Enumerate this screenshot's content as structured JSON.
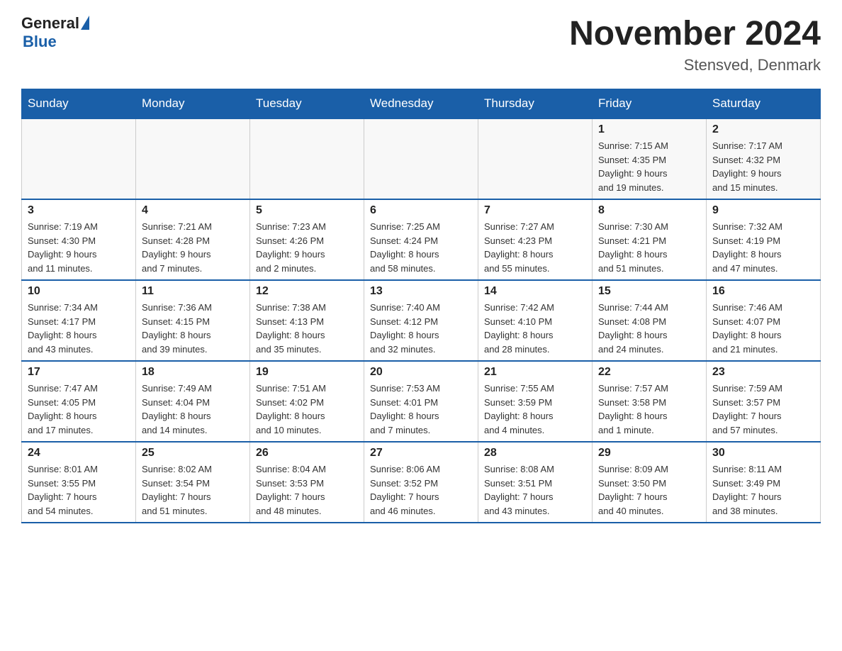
{
  "logo": {
    "general": "General",
    "blue": "Blue"
  },
  "header": {
    "title": "November 2024",
    "location": "Stensved, Denmark"
  },
  "days_of_week": [
    "Sunday",
    "Monday",
    "Tuesday",
    "Wednesday",
    "Thursday",
    "Friday",
    "Saturday"
  ],
  "weeks": [
    [
      {
        "day": "",
        "info": ""
      },
      {
        "day": "",
        "info": ""
      },
      {
        "day": "",
        "info": ""
      },
      {
        "day": "",
        "info": ""
      },
      {
        "day": "",
        "info": ""
      },
      {
        "day": "1",
        "info": "Sunrise: 7:15 AM\nSunset: 4:35 PM\nDaylight: 9 hours\nand 19 minutes."
      },
      {
        "day": "2",
        "info": "Sunrise: 7:17 AM\nSunset: 4:32 PM\nDaylight: 9 hours\nand 15 minutes."
      }
    ],
    [
      {
        "day": "3",
        "info": "Sunrise: 7:19 AM\nSunset: 4:30 PM\nDaylight: 9 hours\nand 11 minutes."
      },
      {
        "day": "4",
        "info": "Sunrise: 7:21 AM\nSunset: 4:28 PM\nDaylight: 9 hours\nand 7 minutes."
      },
      {
        "day": "5",
        "info": "Sunrise: 7:23 AM\nSunset: 4:26 PM\nDaylight: 9 hours\nand 2 minutes."
      },
      {
        "day": "6",
        "info": "Sunrise: 7:25 AM\nSunset: 4:24 PM\nDaylight: 8 hours\nand 58 minutes."
      },
      {
        "day": "7",
        "info": "Sunrise: 7:27 AM\nSunset: 4:23 PM\nDaylight: 8 hours\nand 55 minutes."
      },
      {
        "day": "8",
        "info": "Sunrise: 7:30 AM\nSunset: 4:21 PM\nDaylight: 8 hours\nand 51 minutes."
      },
      {
        "day": "9",
        "info": "Sunrise: 7:32 AM\nSunset: 4:19 PM\nDaylight: 8 hours\nand 47 minutes."
      }
    ],
    [
      {
        "day": "10",
        "info": "Sunrise: 7:34 AM\nSunset: 4:17 PM\nDaylight: 8 hours\nand 43 minutes."
      },
      {
        "day": "11",
        "info": "Sunrise: 7:36 AM\nSunset: 4:15 PM\nDaylight: 8 hours\nand 39 minutes."
      },
      {
        "day": "12",
        "info": "Sunrise: 7:38 AM\nSunset: 4:13 PM\nDaylight: 8 hours\nand 35 minutes."
      },
      {
        "day": "13",
        "info": "Sunrise: 7:40 AM\nSunset: 4:12 PM\nDaylight: 8 hours\nand 32 minutes."
      },
      {
        "day": "14",
        "info": "Sunrise: 7:42 AM\nSunset: 4:10 PM\nDaylight: 8 hours\nand 28 minutes."
      },
      {
        "day": "15",
        "info": "Sunrise: 7:44 AM\nSunset: 4:08 PM\nDaylight: 8 hours\nand 24 minutes."
      },
      {
        "day": "16",
        "info": "Sunrise: 7:46 AM\nSunset: 4:07 PM\nDaylight: 8 hours\nand 21 minutes."
      }
    ],
    [
      {
        "day": "17",
        "info": "Sunrise: 7:47 AM\nSunset: 4:05 PM\nDaylight: 8 hours\nand 17 minutes."
      },
      {
        "day": "18",
        "info": "Sunrise: 7:49 AM\nSunset: 4:04 PM\nDaylight: 8 hours\nand 14 minutes."
      },
      {
        "day": "19",
        "info": "Sunrise: 7:51 AM\nSunset: 4:02 PM\nDaylight: 8 hours\nand 10 minutes."
      },
      {
        "day": "20",
        "info": "Sunrise: 7:53 AM\nSunset: 4:01 PM\nDaylight: 8 hours\nand 7 minutes."
      },
      {
        "day": "21",
        "info": "Sunrise: 7:55 AM\nSunset: 3:59 PM\nDaylight: 8 hours\nand 4 minutes."
      },
      {
        "day": "22",
        "info": "Sunrise: 7:57 AM\nSunset: 3:58 PM\nDaylight: 8 hours\nand 1 minute."
      },
      {
        "day": "23",
        "info": "Sunrise: 7:59 AM\nSunset: 3:57 PM\nDaylight: 7 hours\nand 57 minutes."
      }
    ],
    [
      {
        "day": "24",
        "info": "Sunrise: 8:01 AM\nSunset: 3:55 PM\nDaylight: 7 hours\nand 54 minutes."
      },
      {
        "day": "25",
        "info": "Sunrise: 8:02 AM\nSunset: 3:54 PM\nDaylight: 7 hours\nand 51 minutes."
      },
      {
        "day": "26",
        "info": "Sunrise: 8:04 AM\nSunset: 3:53 PM\nDaylight: 7 hours\nand 48 minutes."
      },
      {
        "day": "27",
        "info": "Sunrise: 8:06 AM\nSunset: 3:52 PM\nDaylight: 7 hours\nand 46 minutes."
      },
      {
        "day": "28",
        "info": "Sunrise: 8:08 AM\nSunset: 3:51 PM\nDaylight: 7 hours\nand 43 minutes."
      },
      {
        "day": "29",
        "info": "Sunrise: 8:09 AM\nSunset: 3:50 PM\nDaylight: 7 hours\nand 40 minutes."
      },
      {
        "day": "30",
        "info": "Sunrise: 8:11 AM\nSunset: 3:49 PM\nDaylight: 7 hours\nand 38 minutes."
      }
    ]
  ]
}
